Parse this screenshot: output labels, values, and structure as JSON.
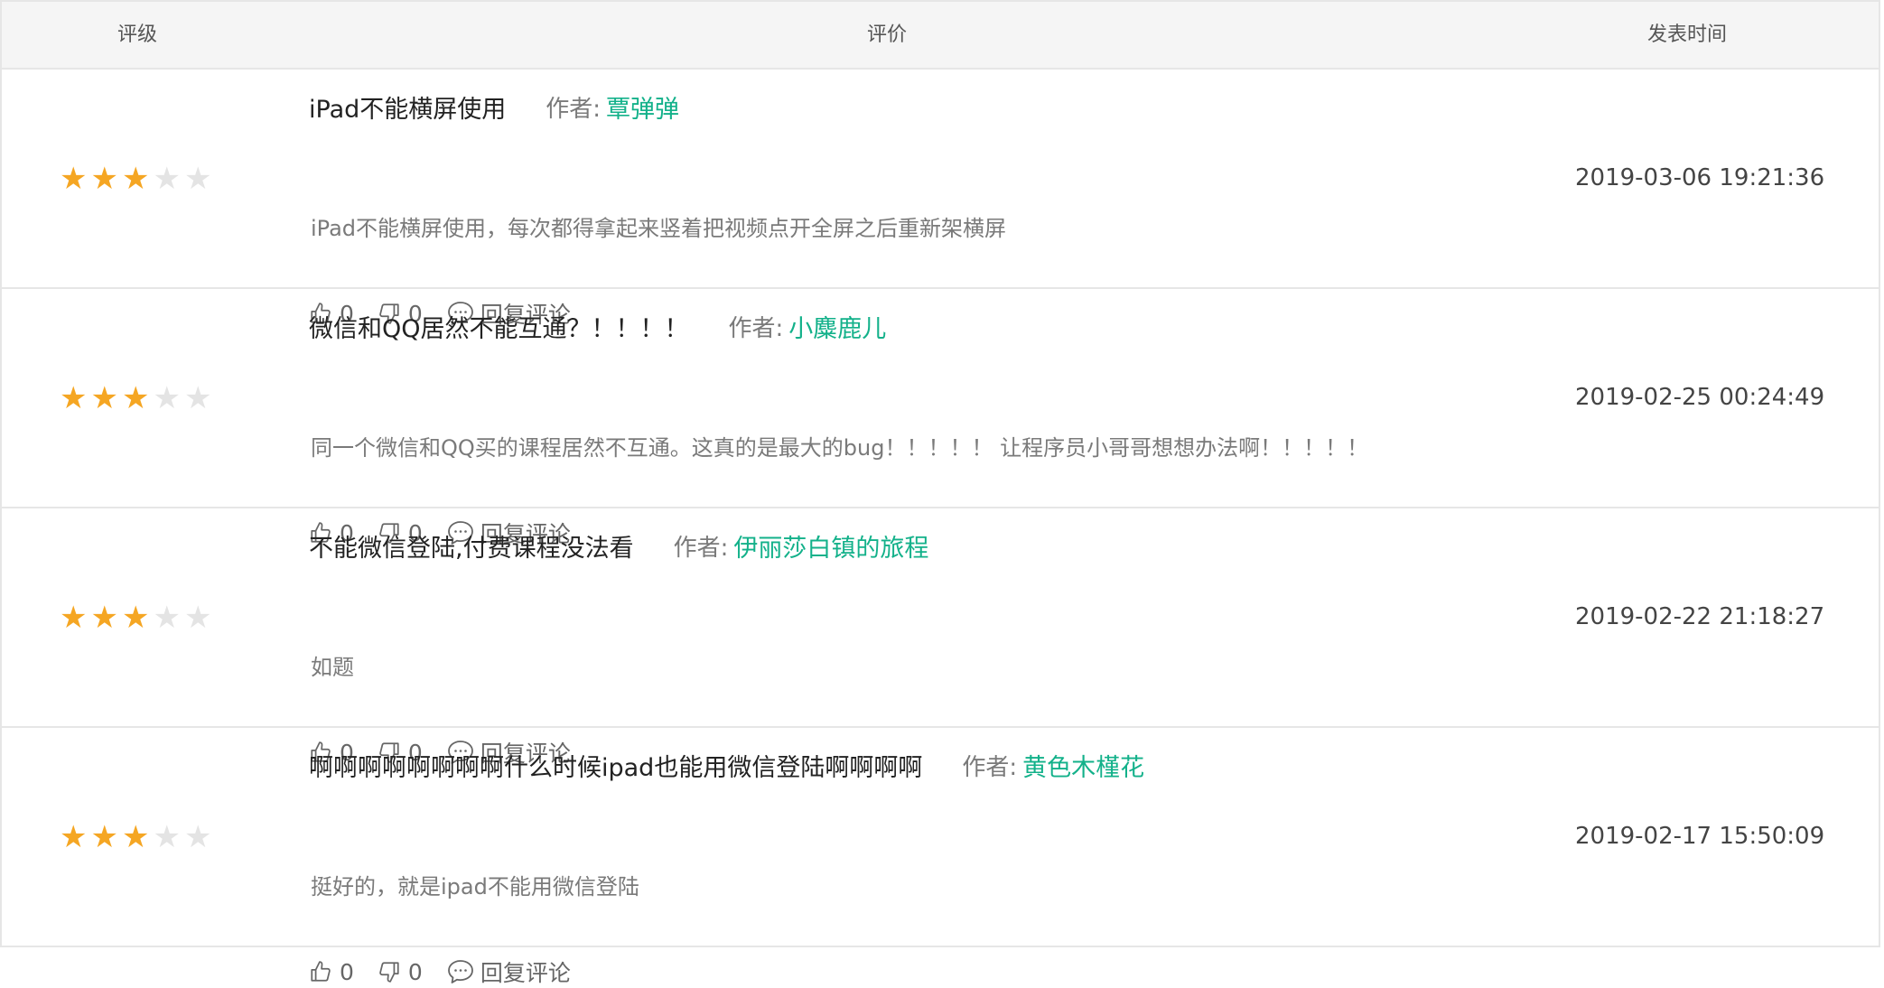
{
  "header": {
    "rating": "评级",
    "review": "评价",
    "time": "发表时间"
  },
  "author_label": "作者:",
  "reply_label": "回复评论",
  "colors": {
    "accent": "#13b18a",
    "star_on": "#f5a623",
    "star_off": "#e4e4e4"
  },
  "reviews": [
    {
      "stars": 3,
      "max_stars": 5,
      "title": "iPad不能横屏使用",
      "author": "覃弹弹",
      "content": "iPad不能横屏使用，每次都得拿起来竖着把视频点开全屏之后重新架横屏",
      "likes": "0",
      "dislikes": "0",
      "time": "2019-03-06 19:21:36"
    },
    {
      "stars": 3,
      "max_stars": 5,
      "title": "微信和QQ居然不能互通？！！！！",
      "author": "小麋鹿儿",
      "content": "同一个微信和QQ买的课程居然不互通。这真的是最大的bug！！！！！ 让程序员小哥哥想想办法啊！！！！！",
      "likes": "0",
      "dislikes": "0",
      "time": "2019-02-25 00:24:49"
    },
    {
      "stars": 3,
      "max_stars": 5,
      "title": "不能微信登陆,付费课程没法看",
      "author": "伊丽莎白镇的旅程",
      "content": "如题",
      "likes": "0",
      "dislikes": "0",
      "time": "2019-02-22 21:18:27"
    },
    {
      "stars": 3,
      "max_stars": 5,
      "title": "啊啊啊啊啊啊啊啊什么时候ipad也能用微信登陆啊啊啊啊",
      "author": "黄色木槿花",
      "content": "挺好的，就是ipad不能用微信登陆",
      "likes": "0",
      "dislikes": "0",
      "time": "2019-02-17 15:50:09"
    }
  ]
}
